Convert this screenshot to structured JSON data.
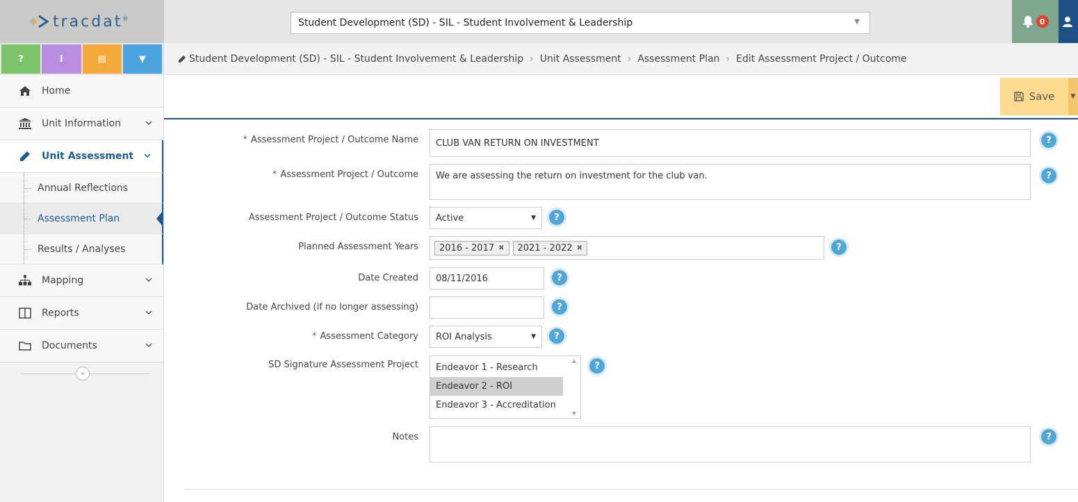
{
  "app": {
    "brand": "tracdat",
    "brand_mark": "®"
  },
  "header": {
    "unit_select": "Student Development (SD) - SIL - Student Involvement & Leadership",
    "notification_count": "0"
  },
  "quick_buttons": [
    {
      "label": "?",
      "color": "#7dc36a"
    },
    {
      "label": "i",
      "color": "#b98de0"
    },
    {
      "label": "▤",
      "color": "#f6a93b"
    },
    {
      "label": "▼",
      "color": "#4aa3df"
    }
  ],
  "sidebar": {
    "home": "Home",
    "unit_information": "Unit Information",
    "unit_assessment": "Unit Assessment",
    "sub_items": [
      "Annual Reflections",
      "Assessment Plan",
      "Results / Analyses"
    ],
    "mapping": "Mapping",
    "reports": "Reports",
    "documents": "Documents",
    "collapse": "«"
  },
  "breadcrumb": [
    "Student Development (SD) - SIL - Student Involvement & Leadership",
    "Unit Assessment",
    "Assessment Plan",
    "Edit Assessment Project / Outcome"
  ],
  "toolbar": {
    "save_label": "Save"
  },
  "form": {
    "name_label": "Assessment Project / Outcome Name",
    "name_value": "CLUB VAN RETURN ON INVESTMENT",
    "desc_label": "Assessment Project / Outcome",
    "desc_value": "We are assessing the return on investment for the club van.",
    "status_label": "Assessment Project / Outcome Status",
    "status_value": "Active",
    "years_label": "Planned Assessment Years",
    "years": [
      "2016 - 2017",
      "2021 - 2022"
    ],
    "created_label": "Date Created",
    "created_value": "08/11/2016",
    "archived_label": "Date Archived (if no longer assessing)",
    "archived_value": "",
    "category_label": "Assessment Category",
    "category_value": "ROI Analysis",
    "signature_label": "SD Signature Assessment Project",
    "signature_options": [
      "Endeavor 1 - Research",
      "Endeavor 2 - ROI",
      "Endeavor 3 - Accreditation"
    ],
    "notes_label": "Notes",
    "notes_value": "",
    "required_mark": "*",
    "help_glyph": "?"
  }
}
